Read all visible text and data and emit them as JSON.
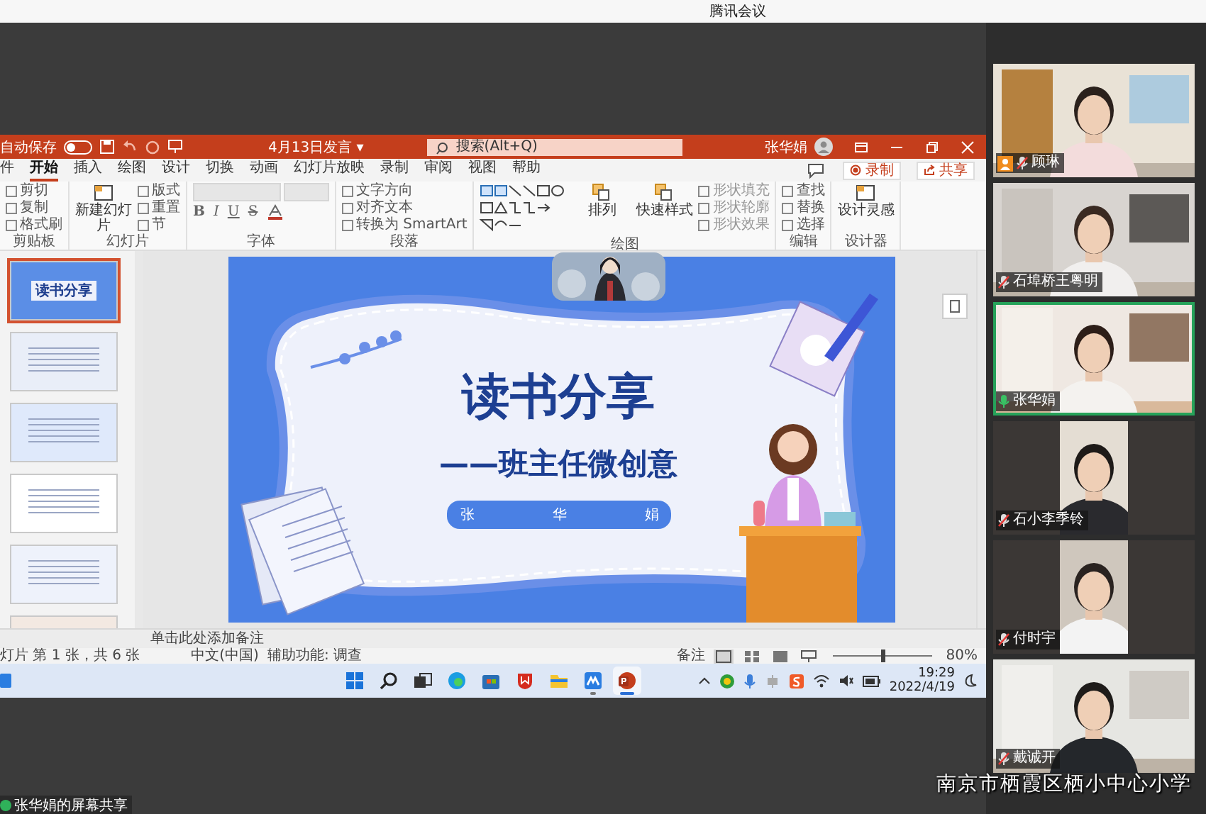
{
  "app_title": "腾讯会议",
  "ppt": {
    "autosave": {
      "label": "自动保存",
      "on": false
    },
    "doc_title": "4月13日发言 ▾",
    "search": {
      "placeholder": "搜索(Alt+Q)"
    },
    "user": "张华娟",
    "tabs": [
      {
        "label": "件",
        "selected": false
      },
      {
        "label": "开始",
        "selected": true
      },
      {
        "label": "插入",
        "selected": false
      },
      {
        "label": "绘图",
        "selected": false
      },
      {
        "label": "设计",
        "selected": false
      },
      {
        "label": "切换",
        "selected": false
      },
      {
        "label": "动画",
        "selected": false
      },
      {
        "label": "幻灯片放映",
        "selected": false
      },
      {
        "label": "录制",
        "selected": false
      },
      {
        "label": "审阅",
        "selected": false
      },
      {
        "label": "视图",
        "selected": false
      },
      {
        "label": "帮助",
        "selected": false
      }
    ],
    "record_button": "录制",
    "share_button": "共享",
    "ribbon_groups": [
      {
        "kind": "list",
        "label": "剪贴板",
        "items": [
          "剪切",
          "复制",
          "格式刷"
        ]
      },
      {
        "kind": "big",
        "label": "幻灯片",
        "big": [
          "新建幻灯片"
        ],
        "items": [
          "版式",
          "重置",
          "节"
        ]
      },
      {
        "kind": "font",
        "label": "字体",
        "items": [
          "B",
          "I",
          "U",
          "S"
        ]
      },
      {
        "kind": "list",
        "label": "段落",
        "items": [
          "文字方向",
          "对齐文本",
          "转换为 SmartArt"
        ]
      },
      {
        "kind": "shapes",
        "label": "绘图",
        "big": [
          "排列",
          "快速样式"
        ],
        "items": [
          "形状填充",
          "形状轮廓",
          "形状效果"
        ]
      },
      {
        "kind": "list",
        "label": "编辑",
        "items": [
          "查找",
          "替换",
          "选择"
        ]
      },
      {
        "kind": "big",
        "label": "设计器",
        "big": [
          "设计灵感"
        ]
      }
    ],
    "slides": [
      {
        "selected": true,
        "title": "读书分享"
      },
      {
        "selected": false
      },
      {
        "selected": false
      },
      {
        "selected": false
      },
      {
        "selected": false
      },
      {
        "selected": false
      }
    ],
    "slide": {
      "title": "读书分享",
      "subtitle": "——班主任微创意",
      "presenter": "张华娟"
    },
    "notes_placeholder": "单击此处添加备注",
    "status": {
      "slide_info": "灯片 第 1 张，共 6 张",
      "language": "中文(中国)",
      "accessibility": "辅助功能: 调查",
      "notes": "备注",
      "zoom_slider": {
        "level": 0.5
      },
      "zoom": "80%"
    }
  },
  "taskbar": {
    "apps": [
      {
        "kind": "windows",
        "running": false,
        "active": false
      },
      {
        "kind": "search",
        "running": false,
        "active": false
      },
      {
        "kind": "taskview",
        "running": false,
        "active": false
      },
      {
        "kind": "edge",
        "running": false,
        "active": false
      },
      {
        "kind": "store",
        "running": false,
        "active": false
      },
      {
        "kind": "shield",
        "running": false,
        "active": false
      },
      {
        "kind": "folder",
        "running": false,
        "active": false
      },
      {
        "kind": "meeting",
        "running": true,
        "active": false
      },
      {
        "kind": "powerpoint",
        "running": true,
        "active": true
      }
    ],
    "time": "19:29",
    "date": "2022/4/19"
  },
  "participants": [
    {
      "name": "顾琳",
      "muted": true,
      "speaking": false,
      "host": true,
      "kind": "landscape"
    },
    {
      "name": "石埠桥王粤明",
      "muted": true,
      "speaking": false,
      "host": false,
      "kind": "landscape"
    },
    {
      "name": "张华娟",
      "muted": false,
      "speaking": true,
      "host": false,
      "kind": "landscape"
    },
    {
      "name": "石小李季铃",
      "muted": true,
      "speaking": false,
      "host": false,
      "kind": "portrait"
    },
    {
      "name": "付时宇",
      "muted": true,
      "speaking": false,
      "host": false,
      "kind": "portrait"
    },
    {
      "name": "戴诚开",
      "muted": true,
      "speaking": false,
      "host": false,
      "kind": "landscape"
    }
  ],
  "share_label": "张华娟的屏幕共享",
  "caption": "南京市栖霞区栖小中心小学"
}
